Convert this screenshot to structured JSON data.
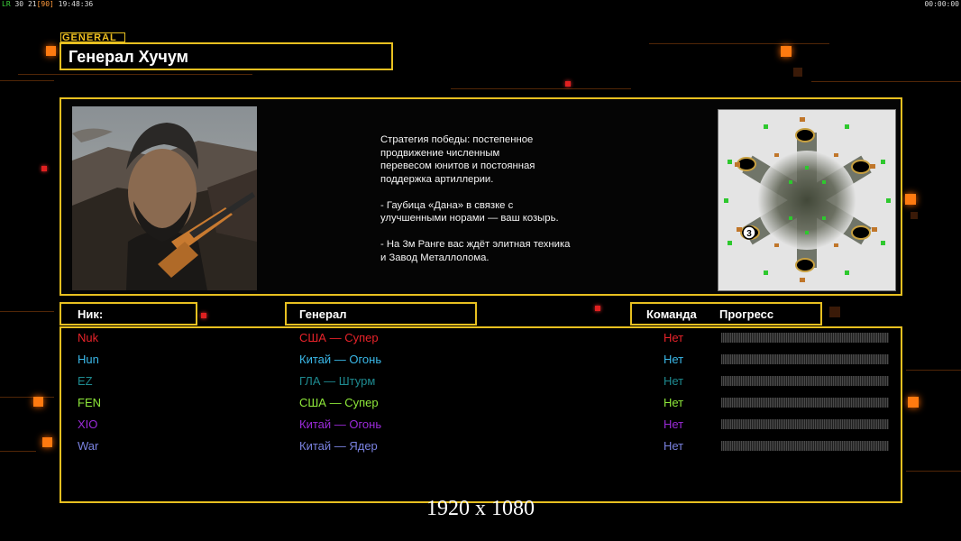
{
  "hud": {
    "left_prefix": "LR",
    "left_a": "30",
    "left_b": "21",
    "left_c": "[90]",
    "left_time": "19:48:36",
    "right_time": "00:00:00"
  },
  "general": {
    "tag": "GENERAL",
    "name": "Генерал Хучум",
    "strategy": "Стратегия победы: постепенное\nпродвижение численным\nперевесом юнитов и постоянная\nподдержка артиллерии.\n\n- Гаубица «Дана» в связке с\nулучшенными норами — ваш козырь.\n\n- На 3м Ранге вас ждёт элитная техника\nи Завод Металлолома."
  },
  "map": {
    "marker": "3"
  },
  "table": {
    "headers": {
      "nick": "Ник:",
      "general": "Генерал",
      "team": "Команда",
      "progress": "Прогресс"
    },
    "players": [
      {
        "nick": "Nuk",
        "general": "США — Супер",
        "team": "Нет",
        "color": "#e8232a",
        "progress": 0
      },
      {
        "nick": "Hun",
        "general": "Китай — Огонь",
        "team": "Нет",
        "color": "#3ab8e8",
        "progress": 0
      },
      {
        "nick": "EZ",
        "general": "ГЛА — Штурм",
        "team": "Нет",
        "color": "#1e8a90",
        "progress": 0
      },
      {
        "nick": "FEN",
        "general": "США — Супер",
        "team": "Нет",
        "color": "#8ee83a",
        "progress": 0
      },
      {
        "nick": "XIO",
        "general": "Китай — Огонь",
        "team": "Нет",
        "color": "#9a2ad8",
        "progress": 0
      },
      {
        "nick": "War",
        "general": "Китай — Ядер",
        "team": "Нет",
        "color": "#7a82e0",
        "progress": 0
      }
    ]
  },
  "resolution_label": "1920 x 1080",
  "colors": {
    "frame": "#e8c020",
    "accent_orange": "#ff7a10"
  }
}
